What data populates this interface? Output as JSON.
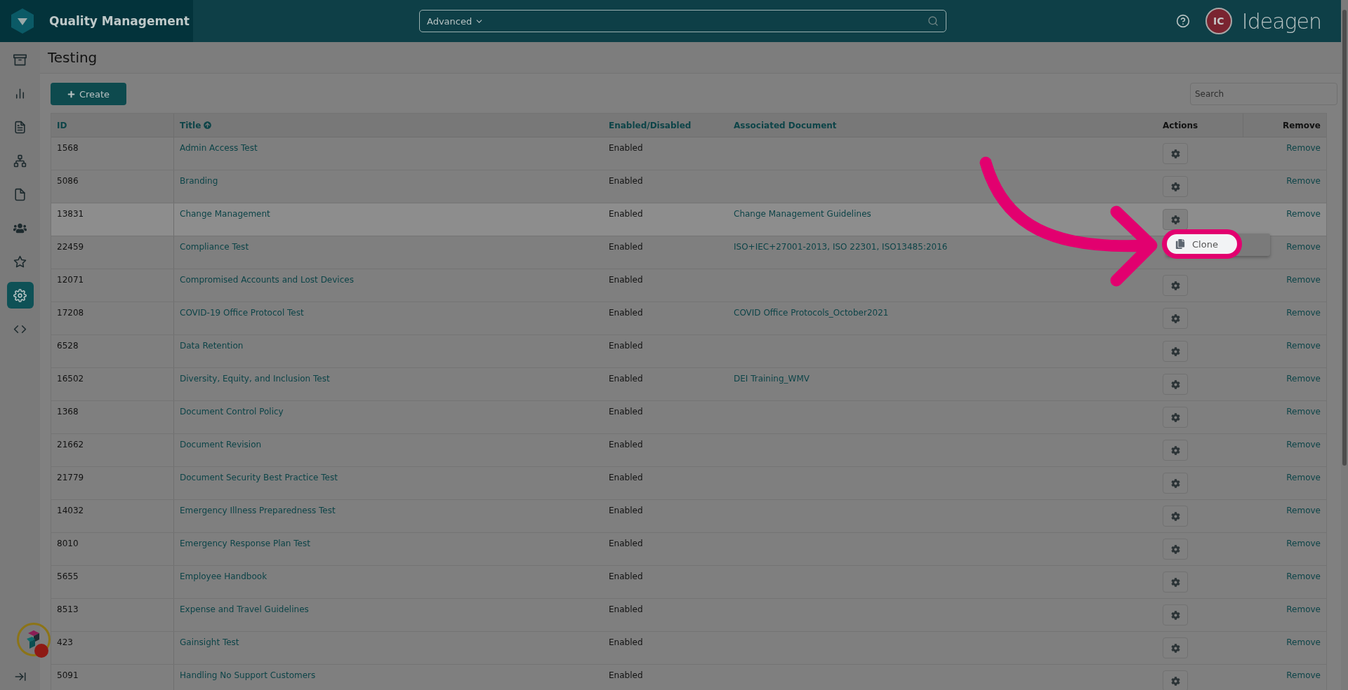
{
  "app": {
    "title": "Quality Management"
  },
  "top_search": {
    "scope": "Advanced"
  },
  "user": {
    "initials": "IC"
  },
  "brand": "Ideagen",
  "sidebar": {
    "items": [
      {
        "selected": false
      },
      {
        "selected": false
      },
      {
        "selected": false
      },
      {
        "selected": false
      },
      {
        "selected": false
      },
      {
        "selected": false
      },
      {
        "selected": false
      },
      {
        "selected": true
      },
      {
        "selected": false
      }
    ]
  },
  "page": {
    "title": "Testing",
    "create_button": "Create",
    "search": {
      "placeholder": "Search"
    }
  },
  "table": {
    "columns": [
      "ID",
      "Title",
      "Enabled/Disabled",
      "Associated Document",
      "Actions",
      "Remove"
    ],
    "rows": [
      {
        "id": "1568",
        "title": "Admin Access Test",
        "status": "Enabled",
        "document": "",
        "remove": "Remove",
        "highlighted": false,
        "menu_open": false
      },
      {
        "id": "5086",
        "title": "Branding",
        "status": "Enabled",
        "document": "",
        "remove": "Remove",
        "highlighted": false,
        "menu_open": false
      },
      {
        "id": "13831",
        "title": "Change Management",
        "status": "Enabled",
        "document": "Change Management Guidelines",
        "remove": "Remove",
        "highlighted": true,
        "menu_open": true
      },
      {
        "id": "22459",
        "title": "Compliance Test",
        "status": "Enabled",
        "document": "ISO+IEC+27001-2013, ISO 22301, ISO13485:2016",
        "remove": "Remove",
        "highlighted": false,
        "menu_open": false
      },
      {
        "id": "12071",
        "title": "Compromised Accounts and Lost Devices",
        "status": "Enabled",
        "document": "",
        "remove": "Remove",
        "highlighted": false,
        "menu_open": false
      },
      {
        "id": "17208",
        "title": "COVID-19 Office Protocol Test",
        "status": "Enabled",
        "document": "COVID Office Protocols_October2021",
        "remove": "Remove",
        "highlighted": false,
        "menu_open": false
      },
      {
        "id": "6528",
        "title": "Data Retention",
        "status": "Enabled",
        "document": "",
        "remove": "Remove",
        "highlighted": false,
        "menu_open": false
      },
      {
        "id": "16502",
        "title": "Diversity, Equity, and Inclusion Test",
        "status": "Enabled",
        "document": "DEI Training_WMV",
        "remove": "Remove",
        "highlighted": false,
        "menu_open": false
      },
      {
        "id": "1368",
        "title": "Document Control Policy",
        "status": "Enabled",
        "document": "",
        "remove": "Remove",
        "highlighted": false,
        "menu_open": false
      },
      {
        "id": "21662",
        "title": "Document Revision",
        "status": "Enabled",
        "document": "",
        "remove": "Remove",
        "highlighted": false,
        "menu_open": false
      },
      {
        "id": "21779",
        "title": "Document Security Best Practice Test",
        "status": "Enabled",
        "document": "",
        "remove": "Remove",
        "highlighted": false,
        "menu_open": false
      },
      {
        "id": "14032",
        "title": "Emergency Illness Preparedness Test",
        "status": "Enabled",
        "document": "",
        "remove": "Remove",
        "highlighted": false,
        "menu_open": false
      },
      {
        "id": "8010",
        "title": "Emergency Response Plan Test",
        "status": "Enabled",
        "document": "",
        "remove": "Remove",
        "highlighted": false,
        "menu_open": false
      },
      {
        "id": "5655",
        "title": "Employee Handbook",
        "status": "Enabled",
        "document": "",
        "remove": "Remove",
        "highlighted": false,
        "menu_open": false
      },
      {
        "id": "8513",
        "title": "Expense and Travel Guidelines",
        "status": "Enabled",
        "document": "",
        "remove": "Remove",
        "highlighted": false,
        "menu_open": false
      },
      {
        "id": "423",
        "title": "Gainsight Test",
        "status": "Enabled",
        "document": "",
        "remove": "Remove",
        "highlighted": false,
        "menu_open": false
      },
      {
        "id": "5091",
        "title": "Handling No Support Customers",
        "status": "Enabled",
        "document": "",
        "remove": "Remove",
        "highlighted": false,
        "menu_open": false
      }
    ]
  },
  "row_menu": {
    "items": [
      {
        "label": "Clone",
        "highlighted": true
      }
    ]
  }
}
